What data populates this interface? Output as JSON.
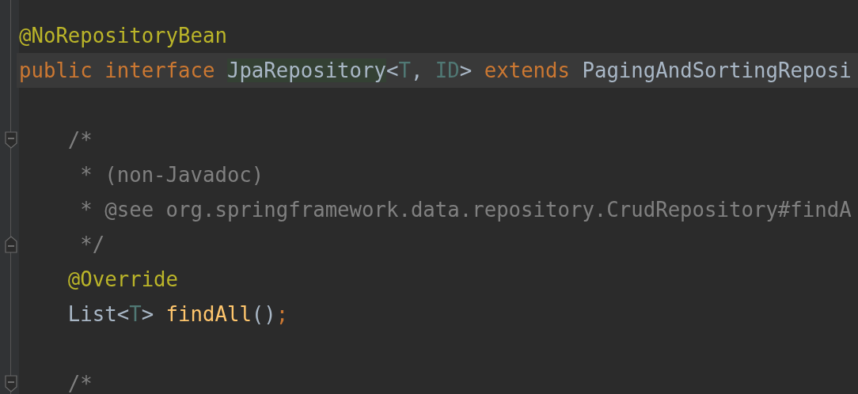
{
  "editor": {
    "lines": [
      {
        "kind": "code",
        "current": false,
        "tokens": [
          {
            "kind": "annotation",
            "text": "@NoRepositoryBean"
          }
        ]
      },
      {
        "kind": "code",
        "current": true,
        "tokens": [
          {
            "kind": "keyword",
            "text": "public"
          },
          {
            "kind": "keyword",
            "text": "interface"
          },
          {
            "kind": "usage",
            "text": "JpaRepository"
          },
          {
            "kind": "plain",
            "text": "<"
          },
          {
            "kind": "typeparam",
            "text": "T"
          },
          {
            "kind": "plain",
            "text": ","
          },
          {
            "kind": "typeparam",
            "text": "ID"
          },
          {
            "kind": "plain",
            "text": ">"
          },
          {
            "kind": "keyword",
            "text": "extends"
          },
          {
            "kind": "plain",
            "text": "PagingAndSortingReposi"
          }
        ]
      },
      {
        "kind": "code",
        "current": false
      },
      {
        "kind": "fold-start",
        "current": false,
        "tokens": [
          {
            "kind": "comment",
            "text": "    /*"
          }
        ]
      },
      {
        "kind": "code",
        "current": false,
        "tokens": [
          {
            "kind": "comment",
            "text": "     * (non-Javadoc)"
          }
        ]
      },
      {
        "kind": "code",
        "current": false,
        "tokens": [
          {
            "kind": "comment",
            "text": "     * @see org.springframework.data.repository.CrudRepository#findA"
          }
        ]
      },
      {
        "kind": "fold-end",
        "current": false,
        "tokens": [
          {
            "kind": "comment",
            "text": "     */"
          }
        ]
      },
      {
        "kind": "code",
        "current": false,
        "tokens": [
          {
            "kind": "annotation",
            "text": "    @Override"
          }
        ]
      },
      {
        "kind": "code",
        "current": false,
        "tokens": [
          {
            "kind": "plain",
            "text": "    List<"
          },
          {
            "kind": "typeparam",
            "text": "T"
          },
          {
            "kind": "plain",
            "text": ">"
          },
          {
            "kind": "method",
            "text": "findAll"
          },
          {
            "kind": "plain",
            "text": "()"
          },
          {
            "kind": "keyword",
            "text": ";"
          }
        ]
      },
      {
        "kind": "code",
        "current": false
      },
      {
        "kind": "fold-start",
        "current": false,
        "tokens": [
          {
            "kind": "comment",
            "text": "    /*"
          }
        ]
      }
    ]
  }
}
